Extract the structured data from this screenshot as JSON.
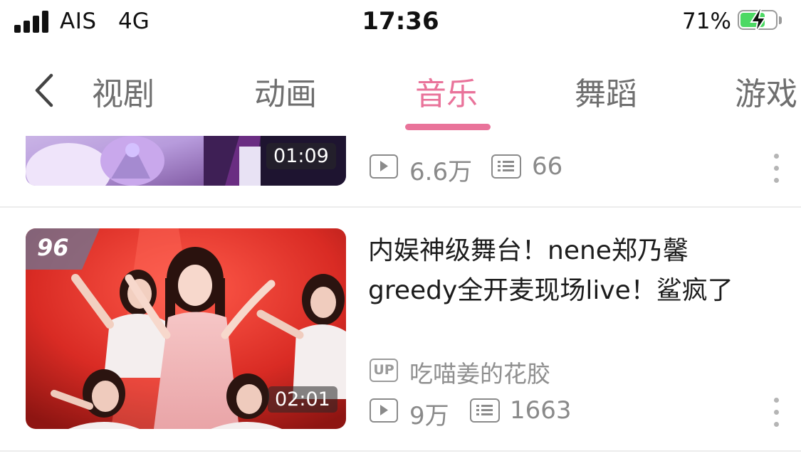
{
  "status_bar": {
    "carrier": "AIS",
    "network": "4G",
    "time": "17:36",
    "battery": "71%",
    "battery_level": 0.71
  },
  "nav": {
    "back_icon": "chevron-left-icon",
    "tabs": [
      {
        "label": "视剧",
        "active": false
      },
      {
        "label": "动画",
        "active": false
      },
      {
        "label": "音乐",
        "active": true
      },
      {
        "label": "舞蹈",
        "active": false
      },
      {
        "label": "游戏",
        "active": false
      }
    ],
    "accent_color": "#e9739a"
  },
  "videos": [
    {
      "duration": "01:09",
      "views": "6.6万",
      "comments": "66"
    },
    {
      "score": "96",
      "duration": "02:01",
      "title_line1": "内娱神级舞台！nene郑乃馨",
      "title_line2": "greedy全开麦现场live！鲨疯了",
      "up_badge": "UP",
      "uploader": "吃喵姜的花胶",
      "views": "9万",
      "comments": "1663"
    }
  ],
  "icons": {
    "views": "play-icon",
    "comments": "danmaku-icon",
    "more": "more-vertical-icon"
  }
}
